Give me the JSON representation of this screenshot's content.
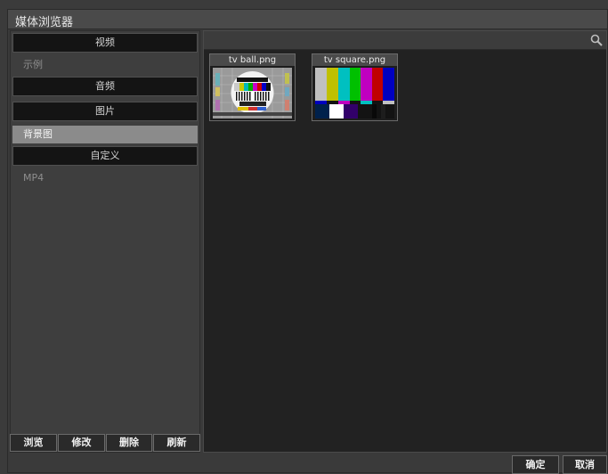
{
  "window": {
    "title": "媒体浏览器"
  },
  "left_panel": {
    "categories": [
      {
        "header": "视频",
        "items": [
          "示例"
        ]
      },
      {
        "header": "音频",
        "items": []
      },
      {
        "header": "图片",
        "items": [
          "背景图"
        ]
      },
      {
        "header": "自定义",
        "items": [
          "MP4"
        ]
      }
    ],
    "selected_item": "背景图",
    "buttons": {
      "browse": "浏览",
      "modify": "修改",
      "delete": "删除",
      "refresh": "刷新"
    }
  },
  "search": {
    "value": "",
    "placeholder": ""
  },
  "media": [
    {
      "name": "tv ball.png",
      "kind": "ball"
    },
    {
      "name": "tv square.png",
      "kind": "square"
    }
  ],
  "footer": {
    "ok": "确定",
    "cancel": "取消"
  },
  "colors": {
    "panel_dark": "#222222",
    "header_black": "#141414",
    "selected_gray": "#8b8b8b"
  }
}
